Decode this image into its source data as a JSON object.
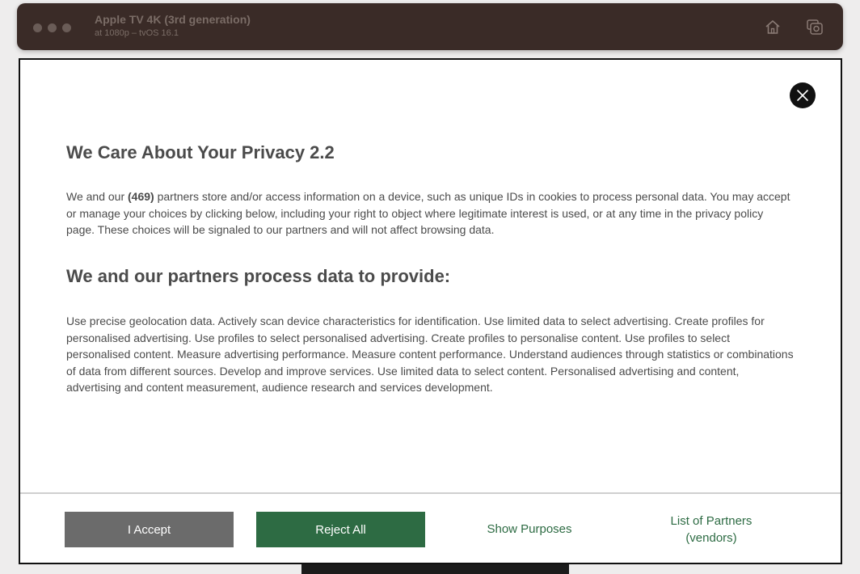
{
  "window": {
    "title": "Apple TV 4K (3rd generation)",
    "subtitle": "at 1080p – tvOS 16.1",
    "home_icon": "home-icon",
    "screenshot_icon": "screenshot-icon"
  },
  "dialog": {
    "close_icon": "close-icon",
    "title": "We Care About Your Privacy 2.2",
    "intro_prefix": "We and our ",
    "partner_count": "(469)",
    "intro_suffix": " partners store and/or access information on a device, such as unique IDs in cookies to process personal data. You may accept or manage your choices by clicking below, including your right to object where legitimate interest is used, or at any time in the privacy policy page. These choices will be signaled to our partners and will not affect browsing data.",
    "purposes_heading": "We and our partners process data to provide:",
    "purposes_text": "Use precise geolocation data. Actively scan device characteristics for identification. Use limited data to select advertising. Create profiles for personalised advertising. Use profiles to select personalised advertising. Create profiles to personalise content. Use profiles to select personalised content. Measure advertising performance. Measure content performance. Understand audiences through statistics or combinations of data from different sources. Develop and improve services. Use limited data to select content. Personalised advertising and content, advertising and content measurement, audience research and services development.",
    "accept_label": "I Accept",
    "reject_label": "Reject All",
    "show_purposes_label": "Show Purposes",
    "partners_label_line1": "List of Partners",
    "partners_label_line2": "(vendors)"
  },
  "colors": {
    "titlebar": "#3a2b27",
    "accept_button": "#6b6b6b",
    "reject_button": "#2d6b43",
    "link": "#2d6b43",
    "text": "#4b4b4b"
  }
}
